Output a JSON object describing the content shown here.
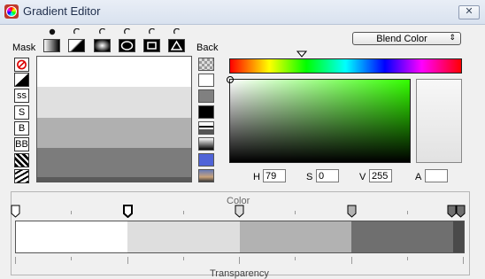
{
  "window": {
    "title": "Gradient Editor",
    "close_label": "✕"
  },
  "mask": {
    "label": "Mask",
    "selected_index": 0,
    "shape_icons": [
      "linear-gradient-icon",
      "corner-gradient-icon",
      "horizontal-bar-icon",
      "ellipse-icon",
      "rectangle-icon",
      "triangle-icon"
    ]
  },
  "back": {
    "label": "Back"
  },
  "tools": [
    {
      "name": "no-mask",
      "label": "⊘"
    },
    {
      "name": "ramp",
      "label": ""
    },
    {
      "name": "ss",
      "label": "ss"
    },
    {
      "name": "s",
      "label": "S"
    },
    {
      "name": "b",
      "label": "B"
    },
    {
      "name": "bb",
      "label": "BB"
    },
    {
      "name": "noise1",
      "label": ""
    },
    {
      "name": "noise2",
      "label": ""
    }
  ],
  "preview_bands": [
    "#ffffff",
    "#e0e0e0",
    "#b0b0b0",
    "#7c7c7c",
    "#5a5a5a"
  ],
  "back_swatches": [
    "checker",
    "#ffffff",
    "#808080",
    "#000000",
    "stripes",
    "ramp",
    "#5064d8",
    "photo"
  ],
  "blend": {
    "value": "Blend Color",
    "arrow": "⇕"
  },
  "hsv": {
    "h_label": "H",
    "h": "79",
    "s_label": "S",
    "s": "0",
    "v_label": "V",
    "v": "255",
    "a_label": "A",
    "a": ""
  },
  "color_label": "Color",
  "transparency_label": "Transparency",
  "gradient_segments": [
    {
      "color": "#ffffff",
      "flex": 126
    },
    {
      "color": "#dedede",
      "flex": 127
    },
    {
      "color": "#b2b2b2",
      "flex": 126
    },
    {
      "color": "#6f6f6f",
      "flex": 115
    },
    {
      "color": "#4a4a4a",
      "flex": 12
    }
  ],
  "color_stops": [
    {
      "pos": 0.0,
      "fill": "#ffffff",
      "selected": false
    },
    {
      "pos": 0.25,
      "fill": "#ffffff",
      "selected": true
    },
    {
      "pos": 0.5,
      "fill": "#dedede",
      "selected": false
    },
    {
      "pos": 0.75,
      "fill": "#b2b2b2",
      "selected": false
    },
    {
      "pos": 0.975,
      "fill": "#6f6f6f",
      "selected": false
    },
    {
      "pos": 0.995,
      "fill": "#6f6f6f",
      "selected": false
    }
  ]
}
